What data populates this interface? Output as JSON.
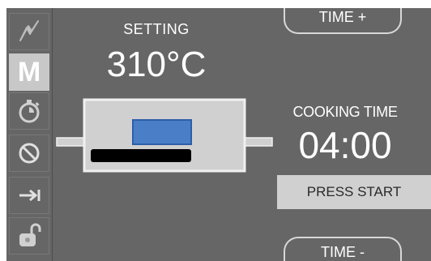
{
  "sidebar": {
    "items": [
      {
        "name": "lightning-icon"
      },
      {
        "name": "manual-mode",
        "label": "M",
        "active": true
      },
      {
        "name": "timer-icon"
      },
      {
        "name": "cancel-icon"
      },
      {
        "name": "arrow-to-line-icon"
      },
      {
        "name": "unlock-icon"
      }
    ]
  },
  "setting": {
    "label": "SETTING",
    "value": "310°C"
  },
  "cooking": {
    "label": "COOKING TIME",
    "value": "04:00"
  },
  "buttons": {
    "time_plus": "TIME +",
    "time_minus": "TIME -",
    "start": "PRESS START"
  },
  "colors": {
    "panel_bg": "#666666",
    "oven_body": "#d0d0d0",
    "oven_element_top": "#4a7fc8",
    "oven_element_bottom": "#000000",
    "start_button_bg": "#d0d0d0"
  }
}
